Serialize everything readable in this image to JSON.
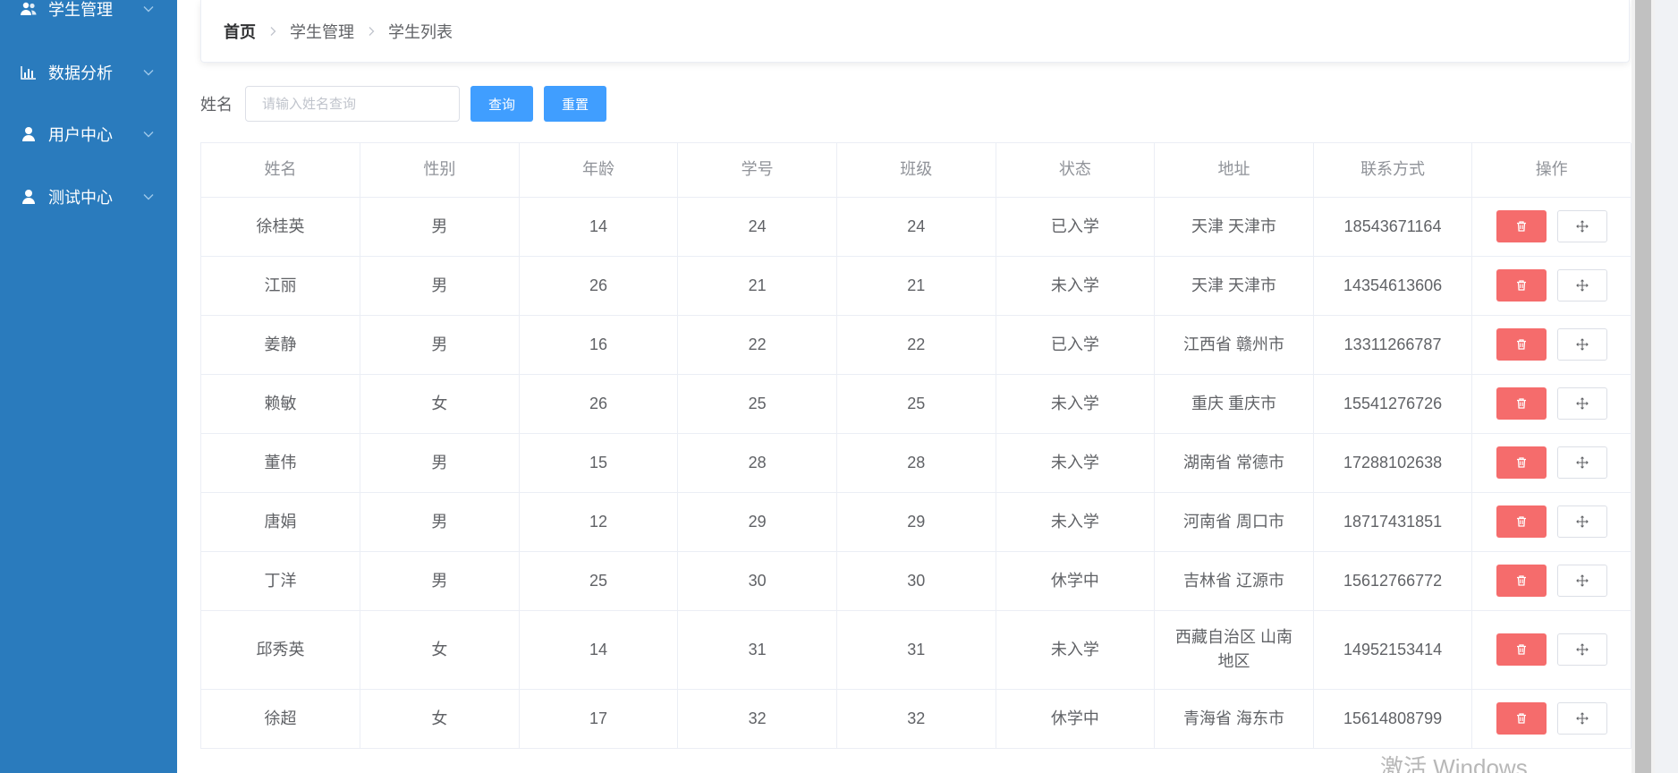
{
  "sidebar": {
    "items": [
      {
        "label": "学生管理",
        "icon": "users-icon"
      },
      {
        "label": "数据分析",
        "icon": "bar-chart-icon"
      },
      {
        "label": "用户中心",
        "icon": "user-icon"
      },
      {
        "label": "测试中心",
        "icon": "user-icon"
      }
    ]
  },
  "breadcrumb": [
    "首页",
    "学生管理",
    "学生列表"
  ],
  "search": {
    "label": "姓名",
    "placeholder": "请输入姓名查询",
    "query_label": "查询",
    "reset_label": "重置"
  },
  "table": {
    "headers": [
      "姓名",
      "性别",
      "年龄",
      "学号",
      "班级",
      "状态",
      "地址",
      "联系方式",
      "操作"
    ],
    "rows": [
      [
        "徐桂英",
        "男",
        "14",
        "24",
        "24",
        "已入学",
        "天津 天津市",
        "18543671164"
      ],
      [
        "江丽",
        "男",
        "26",
        "21",
        "21",
        "未入学",
        "天津 天津市",
        "14354613606"
      ],
      [
        "姜静",
        "男",
        "16",
        "22",
        "22",
        "已入学",
        "江西省 赣州市",
        "13311266787"
      ],
      [
        "赖敏",
        "女",
        "26",
        "25",
        "25",
        "未入学",
        "重庆 重庆市",
        "15541276726"
      ],
      [
        "董伟",
        "男",
        "15",
        "28",
        "28",
        "未入学",
        "湖南省 常德市",
        "17288102638"
      ],
      [
        "唐娟",
        "男",
        "12",
        "29",
        "29",
        "未入学",
        "河南省 周口市",
        "18717431851"
      ],
      [
        "丁洋",
        "男",
        "25",
        "30",
        "30",
        "休学中",
        "吉林省 辽源市",
        "15612766772"
      ],
      [
        "邱秀英",
        "女",
        "14",
        "31",
        "31",
        "未入学",
        "西藏自治区 山南地区",
        "14952153414"
      ],
      [
        "徐超",
        "女",
        "17",
        "32",
        "32",
        "休学中",
        "青海省 海东市",
        "15614808799"
      ]
    ]
  },
  "watermark": "激活 Windows",
  "colors": {
    "sidebar": "#2a7bbd",
    "primary": "#409eff",
    "danger": "#f56c6c"
  }
}
